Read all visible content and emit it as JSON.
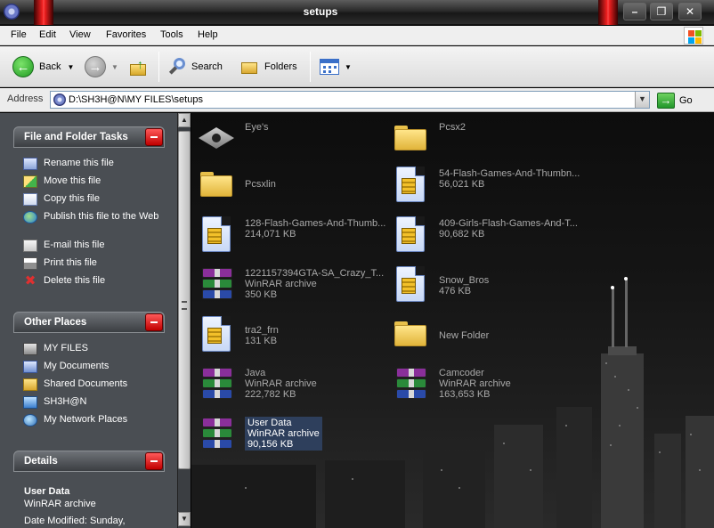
{
  "window": {
    "title": "setups"
  },
  "menu": [
    "File",
    "Edit",
    "View",
    "Favorites",
    "Tools",
    "Help"
  ],
  "toolbar": {
    "back": "Back",
    "search": "Search",
    "folders": "Folders"
  },
  "address": {
    "label": "Address",
    "path": "D:\\SH3H@N\\MY FILES\\setups",
    "go": "Go"
  },
  "tasks_panel": {
    "title": "File and Folder Tasks",
    "items": [
      {
        "label": "Rename this file",
        "icon": "rename-icon"
      },
      {
        "label": "Move this file",
        "icon": "move-icon"
      },
      {
        "label": "Copy this file",
        "icon": "copy-icon"
      },
      {
        "label": "Publish this file to the Web",
        "icon": "publish-web-icon"
      },
      {
        "label": "E-mail this file",
        "icon": "email-icon"
      },
      {
        "label": "Print this file",
        "icon": "print-icon"
      },
      {
        "label": "Delete this file",
        "icon": "delete-icon"
      }
    ]
  },
  "places_panel": {
    "title": "Other Places",
    "items": [
      {
        "label": "MY FILES",
        "icon": "folder-icon"
      },
      {
        "label": "My Documents",
        "icon": "documents-icon"
      },
      {
        "label": "Shared Documents",
        "icon": "folder-icon"
      },
      {
        "label": "SH3H@N",
        "icon": "computer-icon"
      },
      {
        "label": "My Network Places",
        "icon": "network-icon"
      }
    ]
  },
  "details_panel": {
    "title": "Details",
    "name": "User Data",
    "type": "WinRAR archive",
    "modified": "Date Modified: Sunday,"
  },
  "files": [
    {
      "name": "Eye's",
      "line2": "",
      "line3": "",
      "icon": "shortcut-icon"
    },
    {
      "name": "Pcsx2",
      "line2": "",
      "line3": "",
      "icon": "folder-icon"
    },
    {
      "name": "Pcsxlin",
      "line2": "",
      "line3": "",
      "icon": "folder-icon"
    },
    {
      "name": "54-Flash-Games-And-Thumbn...",
      "line2": "56,021 KB",
      "line3": "",
      "icon": "zip-icon"
    },
    {
      "name": "128-Flash-Games-And-Thumb...",
      "line2": "214,071 KB",
      "line3": "",
      "icon": "zip-icon"
    },
    {
      "name": "409-Girls-Flash-Games-And-T...",
      "line2": "90,682 KB",
      "line3": "",
      "icon": "zip-icon"
    },
    {
      "name": "1221157394GTA-SA_Crazy_T...",
      "line2": "WinRAR archive",
      "line3": "350 KB",
      "icon": "rar-icon"
    },
    {
      "name": "Snow_Bros",
      "line2": "476 KB",
      "line3": "",
      "icon": "zip-icon"
    },
    {
      "name": "tra2_frn",
      "line2": "131 KB",
      "line3": "",
      "icon": "zip-icon"
    },
    {
      "name": "New Folder",
      "line2": "",
      "line3": "",
      "icon": "folder-icon"
    },
    {
      "name": "Java",
      "line2": "WinRAR archive",
      "line3": "222,782 KB",
      "icon": "rar-icon"
    },
    {
      "name": "Camcoder",
      "line2": "WinRAR archive",
      "line3": "163,653 KB",
      "icon": "rar-icon"
    },
    {
      "name": "User Data",
      "line2": "WinRAR archive",
      "line3": "90,156 KB",
      "icon": "rar-icon",
      "selected": true
    }
  ]
}
